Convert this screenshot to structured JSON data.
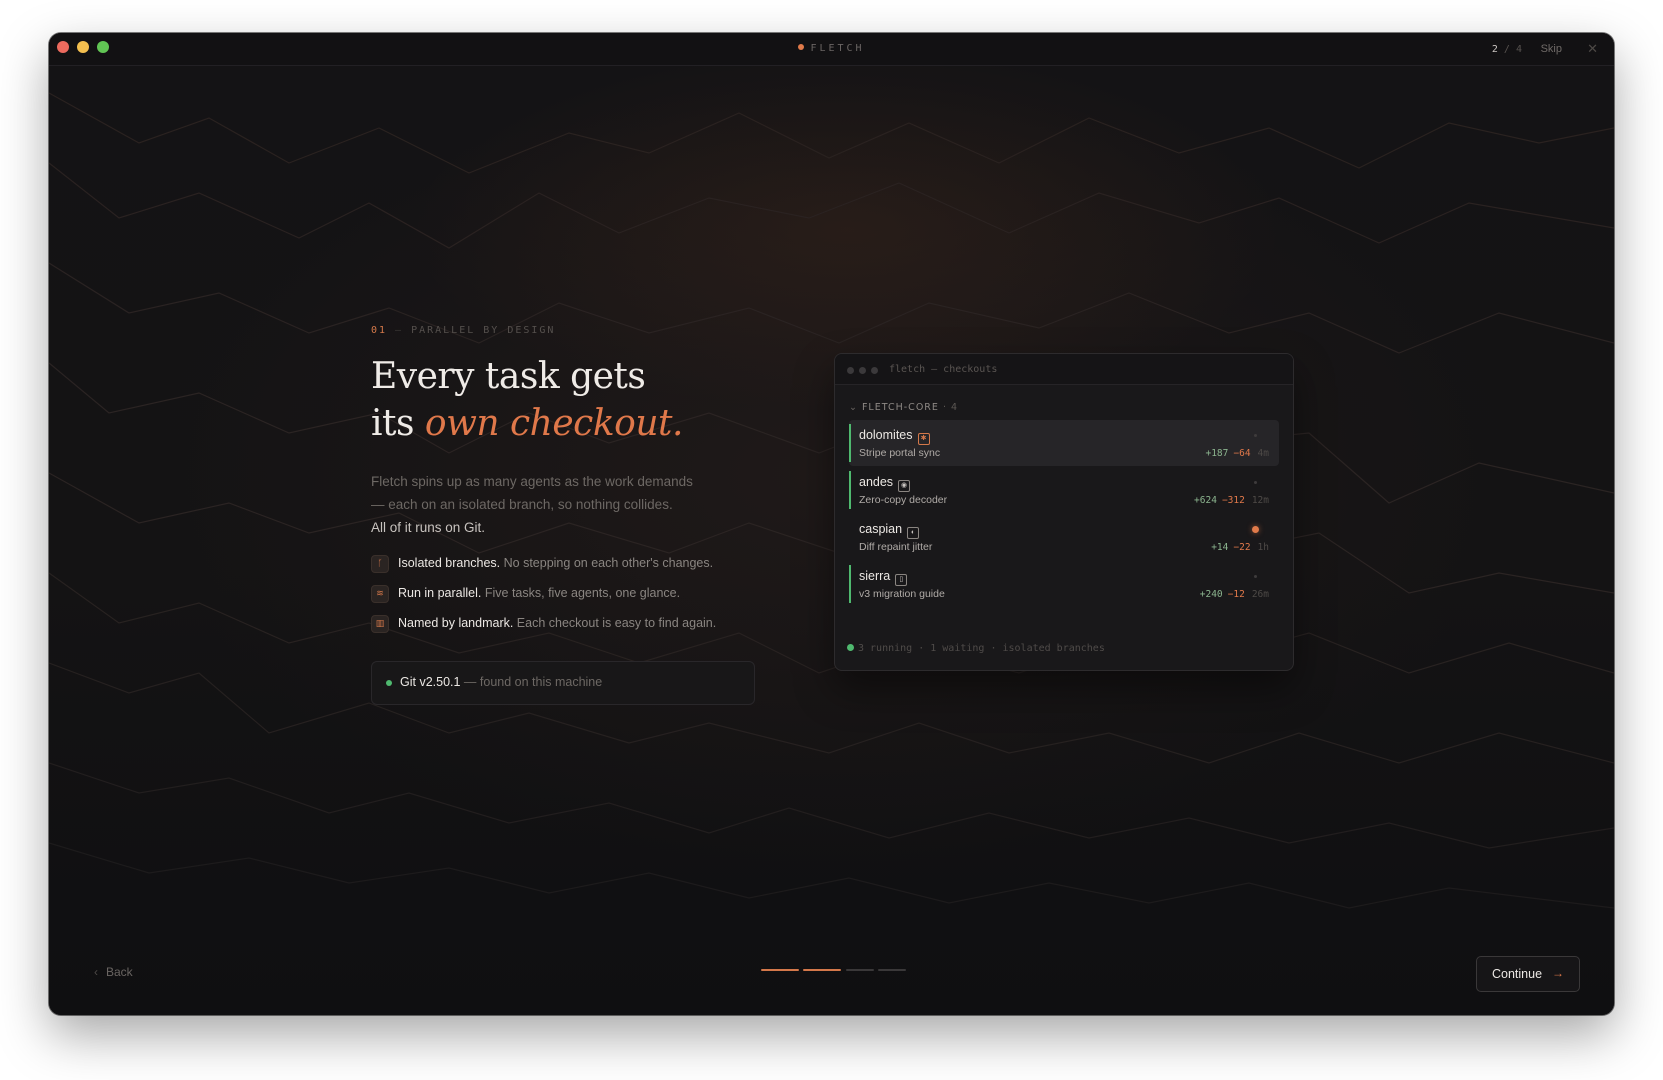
{
  "window": {
    "app_name": "FLETCH",
    "step_current": "2",
    "step_separator": "/",
    "step_total": "4",
    "skip_label": "Skip",
    "close_icon": "✕"
  },
  "hero": {
    "eyebrow_number": "01",
    "eyebrow_dash": "—",
    "eyebrow_label": "PARALLEL BY DESIGN",
    "headline_line1": "Every task gets",
    "headline_line2_plain": "its ",
    "headline_line2_accent": "own checkout.",
    "body_line1": "Fletch spins up as many agents as the work demands",
    "body_line2": "— each on an isolated branch, so nothing collides.",
    "body_line3": "All of it runs on Git."
  },
  "features": [
    {
      "icon": "branch-icon",
      "glyph": "ᚴ",
      "title": "Isolated branches.",
      "desc": " No stepping on each other's changes."
    },
    {
      "icon": "layers-icon",
      "glyph": "≋",
      "title": "Run in parallel.",
      "desc": " Five tasks, five agents, one glance."
    },
    {
      "icon": "map-icon",
      "glyph": "▥",
      "title": "Named by landmark.",
      "desc": " Each checkout is easy to find again."
    }
  ],
  "git_status": {
    "version": "Git v2.50.1",
    "suffix": " — found on this machine",
    "status_color": "#4fb96f"
  },
  "preview": {
    "title": "fletch — checkouts",
    "group_chevron": "⌄",
    "group_name": "FLETCH-CORE",
    "group_sep": "·",
    "group_count": "4",
    "rows": [
      {
        "name": "dolomites",
        "icon_glyph": "✱",
        "desc": "Stripe portal sync",
        "add": "+187",
        "del": "−64",
        "age": "4m"
      },
      {
        "name": "andes",
        "icon_glyph": "◉",
        "desc": "Zero-copy decoder",
        "add": "+624",
        "del": "−312",
        "age": "12m"
      },
      {
        "name": "caspian",
        "icon_glyph": "◐",
        "desc": "Diff repaint jitter",
        "add": "+14",
        "del": "−22",
        "age": "1h"
      },
      {
        "name": "sierra",
        "icon_glyph": "▯",
        "desc": "v3 migration guide",
        "add": "+240",
        "del": "−12",
        "age": "26m"
      }
    ],
    "footer": "3 running · 1 waiting · isolated branches"
  },
  "nav": {
    "back_chevron": "‹",
    "back_label": "Back",
    "continue_label": "Continue",
    "continue_arrow": "→",
    "progress_steps_total": 4,
    "progress_steps_done": 2
  },
  "colors": {
    "accent": "#e07a4a",
    "success": "#4fb96f",
    "background": "#121113"
  }
}
